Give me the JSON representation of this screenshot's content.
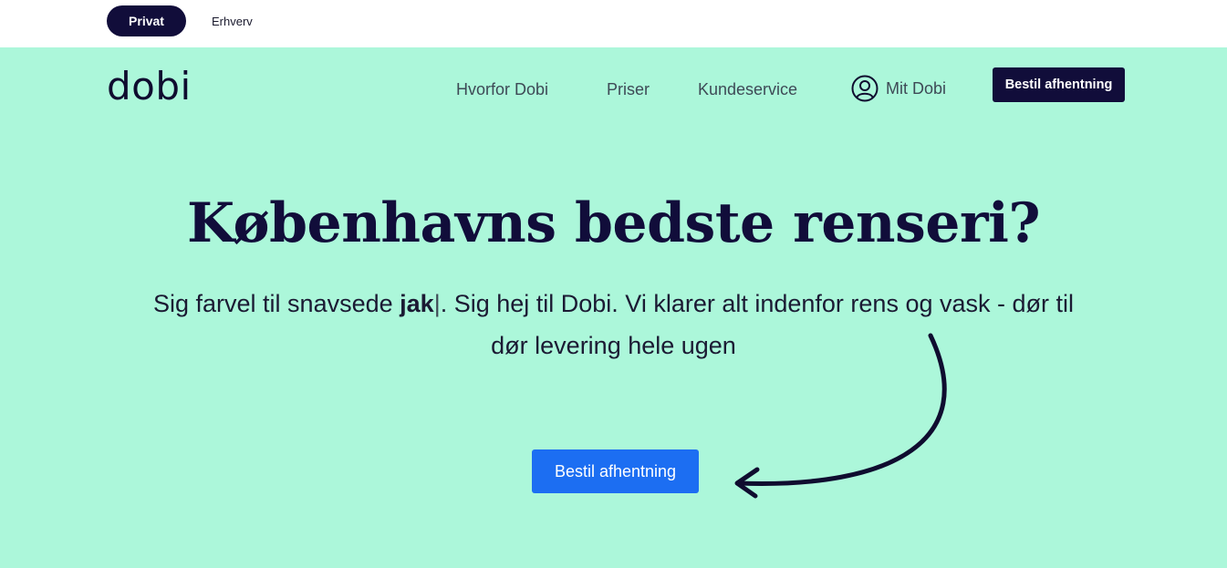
{
  "top_bar": {
    "segments": [
      {
        "label": "Privat",
        "active": true
      },
      {
        "label": "Erhverv",
        "active": false
      }
    ]
  },
  "header": {
    "logo": "dobi",
    "nav": [
      {
        "label": "Hvorfor Dobi"
      },
      {
        "label": "Priser"
      },
      {
        "label": "Kundeservice"
      }
    ],
    "account": {
      "label": "Mit Dobi",
      "icon": "user-circle-icon"
    },
    "cta_label": "Bestil afhentning"
  },
  "hero": {
    "headline": "Københavns bedste renseri?",
    "subtitle_before": "Sig farvel til snavsede ",
    "subtitle_typed": "jak",
    "subtitle_caret": "|",
    "subtitle_after": ". Sig hej til Dobi. Vi klarer alt indenfor rens og vask - dør til dør levering hele ugen",
    "cta_label": "Bestil afhentning",
    "arrow_icon": "curved-arrow-icon"
  },
  "colors": {
    "hero_bg": "#acf7da",
    "navy": "#110d3a",
    "primary_blue": "#1c6ef2"
  }
}
